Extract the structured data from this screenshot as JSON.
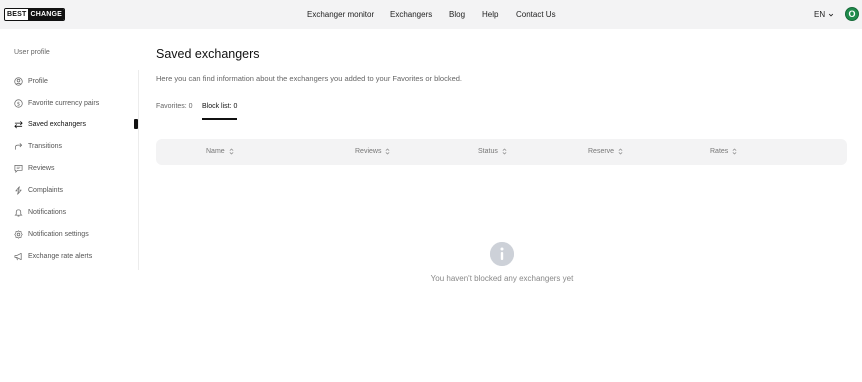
{
  "header": {
    "logo_part1": "BEST",
    "logo_part2": "CHANGE",
    "nav": [
      "Exchanger monitor",
      "Exchangers",
      "Blog",
      "Help",
      "Contact Us"
    ],
    "language": "EN",
    "avatar_letter": "O",
    "avatar_color": "#1f8b4c"
  },
  "sidebar": {
    "title": "User profile",
    "items": [
      {
        "label": "Profile",
        "icon": "user-circle-icon"
      },
      {
        "label": "Favorite currency pairs",
        "icon": "dollar-circle-icon"
      },
      {
        "label": "Saved exchangers",
        "icon": "arrows-swap-icon",
        "active": true
      },
      {
        "label": "Transitions",
        "icon": "share-arrow-icon"
      },
      {
        "label": "Reviews",
        "icon": "chat-bubble-icon"
      },
      {
        "label": "Complaints",
        "icon": "lightning-icon"
      },
      {
        "label": "Notifications",
        "icon": "bell-icon"
      },
      {
        "label": "Notification settings",
        "icon": "gear-icon"
      },
      {
        "label": "Exchange rate alerts",
        "icon": "megaphone-icon"
      }
    ]
  },
  "main": {
    "title": "Saved exchangers",
    "description": "Here you can find information about the exchangers you added to your Favorites or blocked.",
    "tabs": [
      {
        "label": "Favorites: 0",
        "active": false
      },
      {
        "label": "Block list: 0",
        "active": true
      }
    ],
    "columns": [
      "Name",
      "Reviews",
      "Status",
      "Reserve",
      "Rates"
    ],
    "empty_message": "You haven't blocked any exchangers yet"
  }
}
